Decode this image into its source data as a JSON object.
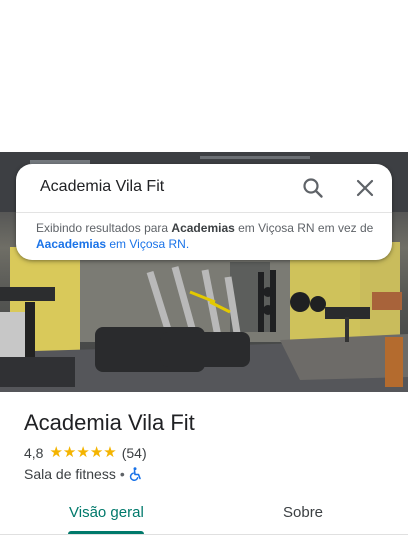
{
  "search": {
    "query": "Academia Vila Fit",
    "notice": {
      "prefix": "Exibindo resultados para ",
      "shown_term": "Academias",
      "shown_location": " em Viçosa RN em vez de ",
      "original_term": "Aacademias",
      "original_location": " em Viçosa RN."
    }
  },
  "place": {
    "name": "Academia Vila Fit",
    "rating": "4,8",
    "stars": 5,
    "review_count": "(54)",
    "category": "Sala de fitness",
    "separator": "•"
  },
  "tabs": [
    {
      "label": "Visão geral",
      "active": true
    },
    {
      "label": "Sobre",
      "active": false
    }
  ],
  "colors": {
    "accent": "#00796b",
    "star": "#f4b400",
    "link": "#1a73e8",
    "accessibility_icon": "#1a73e8"
  },
  "icons": {
    "search": "search-icon",
    "close": "close-icon",
    "star": "star-icon",
    "accessibility": "wheelchair-icon"
  }
}
